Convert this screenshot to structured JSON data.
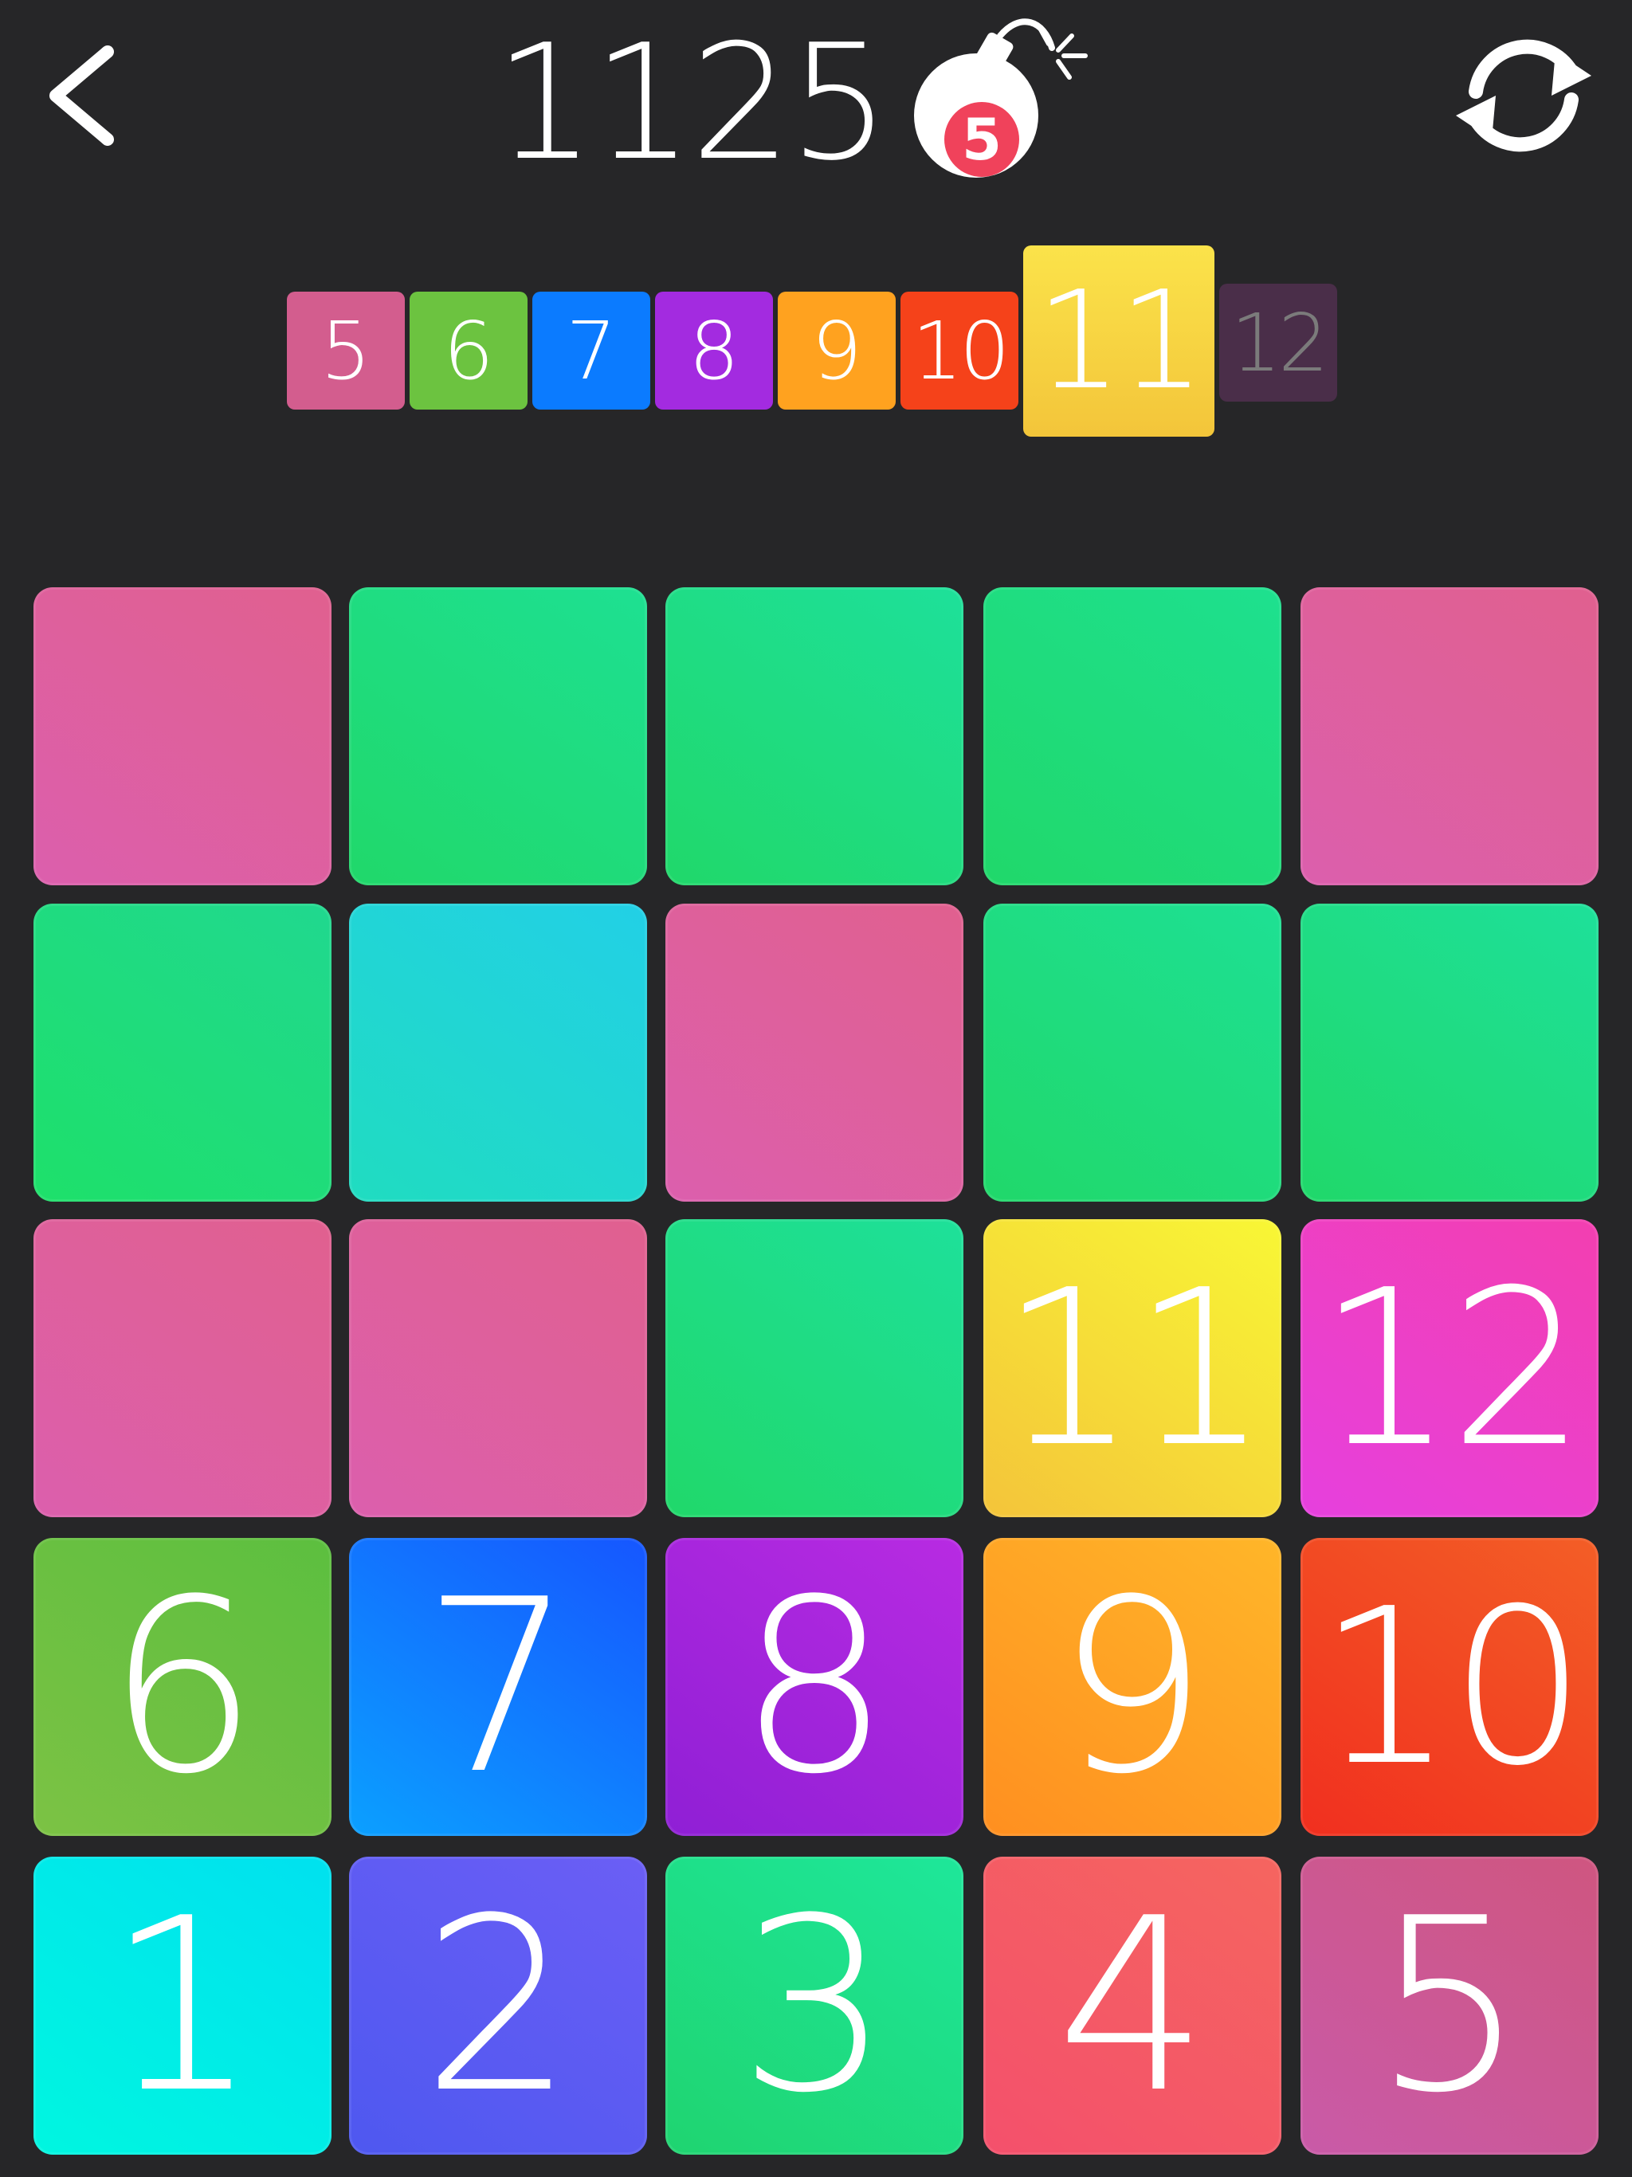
{
  "header": {
    "score": "1125",
    "bomb_count": "5",
    "back_icon": "chevron-left-icon",
    "bomb_icon": "bomb-icon",
    "restart_icon": "restart-icon"
  },
  "progress": {
    "tiles": [
      {
        "label": "5",
        "color": "#d35d8e",
        "state": "unlocked"
      },
      {
        "label": "6",
        "color": "#6cc340",
        "state": "unlocked"
      },
      {
        "label": "7",
        "color": "#0b7bff",
        "state": "unlocked"
      },
      {
        "label": "8",
        "color": "#a32be0",
        "state": "unlocked"
      },
      {
        "label": "9",
        "color": "#ffa21f",
        "state": "unlocked"
      },
      {
        "label": "10",
        "color": "#f5421a",
        "state": "unlocked"
      },
      {
        "label": "11",
        "color": "#f8c83a",
        "state": "current"
      },
      {
        "label": "12",
        "color": "#4a2e49",
        "state": "locked"
      }
    ]
  },
  "board": {
    "rows": [
      [
        {
          "label": "",
          "color_a": "#e0608f",
          "color_b": "#dc5fad"
        },
        {
          "label": "",
          "color_a": "#1ee092",
          "color_b": "#20d86a"
        },
        {
          "label": "",
          "color_a": "#1ee09a",
          "color_b": "#20d86a"
        },
        {
          "label": "",
          "color_a": "#1ee08f",
          "color_b": "#20d86a"
        },
        {
          "label": "",
          "color_a": "#e0608f",
          "color_b": "#dc5fad"
        }
      ],
      [
        {
          "label": "",
          "color_a": "#20d88f",
          "color_b": "#1ee06a"
        },
        {
          "label": "",
          "color_a": "#22d0e6",
          "color_b": "#20dcc0"
        },
        {
          "label": "",
          "color_a": "#e0608f",
          "color_b": "#dc5fad"
        },
        {
          "label": "",
          "color_a": "#1ee094",
          "color_b": "#20d86a"
        },
        {
          "label": "",
          "color_a": "#1ee09a",
          "color_b": "#20d86a"
        }
      ],
      [
        {
          "label": "",
          "color_a": "#e0608f",
          "color_b": "#dc5fad"
        },
        {
          "label": "",
          "color_a": "#e0608f",
          "color_b": "#dc5fad"
        },
        {
          "label": "",
          "color_a": "#1ee09a",
          "color_b": "#20d86a"
        },
        {
          "label": "11",
          "color_a": "#f8f735",
          "color_b": "#f4c43a"
        },
        {
          "label": "12",
          "color_a": "#f33fb0",
          "color_b": "#e640de"
        }
      ],
      [
        {
          "label": "6",
          "color_a": "#5cbf3f",
          "color_b": "#7cc244"
        },
        {
          "label": "7",
          "color_a": "#1656ff",
          "color_b": "#0ba0ff"
        },
        {
          "label": "8",
          "color_a": "#b82be2",
          "color_b": "#8f1fd5"
        },
        {
          "label": "9",
          "color_a": "#ffb629",
          "color_b": "#ff8f20"
        },
        {
          "label": "10",
          "color_a": "#f35e26",
          "color_b": "#f12f1f"
        }
      ],
      [
        {
          "label": "1",
          "color_a": "#00e1ef",
          "color_b": "#00f6e0"
        },
        {
          "label": "2",
          "color_a": "#6b5ef5",
          "color_b": "#4e58f0"
        },
        {
          "label": "3",
          "color_a": "#1ee79a",
          "color_b": "#1fd470"
        },
        {
          "label": "4",
          "color_a": "#f5655f",
          "color_b": "#f4506c"
        },
        {
          "label": "5",
          "color_a": "#cf5680",
          "color_b": "#c95aa8"
        }
      ]
    ]
  }
}
